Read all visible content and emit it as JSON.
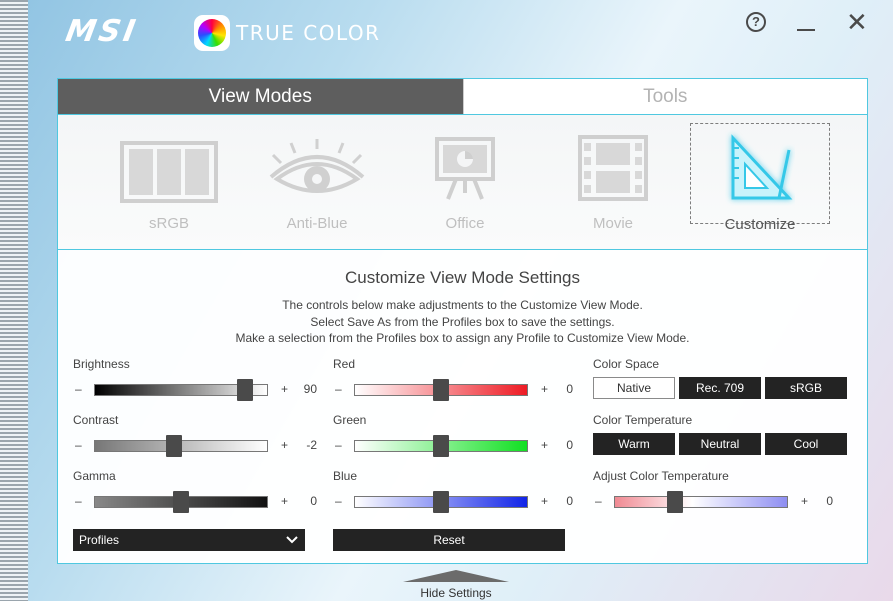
{
  "app": {
    "brand": "MSI",
    "title": "TRUE COLOR"
  },
  "tabs": [
    {
      "label": "View Modes",
      "active": true
    },
    {
      "label": "Tools",
      "active": false
    }
  ],
  "modes": [
    {
      "label": "sRGB",
      "icon": "srgb-grid-icon",
      "selected": false
    },
    {
      "label": "Anti-Blue",
      "icon": "eye-icon",
      "selected": false
    },
    {
      "label": "Office",
      "icon": "presentation-board-icon",
      "selected": false
    },
    {
      "label": "Movie",
      "icon": "film-strip-icon",
      "selected": false
    },
    {
      "label": "Customize",
      "icon": "set-square-icon",
      "selected": true
    }
  ],
  "settings": {
    "title": "Customize View Mode Settings",
    "desc_lines": [
      "The controls below make adjustments to the Customize View Mode.",
      "Select Save As from the Profiles box to save the settings.",
      "Make a selection from the Profiles box to assign any Profile to Customize View Mode."
    ],
    "sliders": {
      "brightness": {
        "label": "Brightness",
        "value": "90",
        "position": 0.87
      },
      "contrast": {
        "label": "Contrast",
        "value": "-2",
        "position": 0.46
      },
      "gamma": {
        "label": "Gamma",
        "value": "0",
        "position": 0.5
      },
      "red": {
        "label": "Red",
        "value": "0",
        "position": 0.5
      },
      "green": {
        "label": "Green",
        "value": "0",
        "position": 0.5
      },
      "blue": {
        "label": "Blue",
        "value": "0",
        "position": 0.5
      },
      "adjust_temp": {
        "label": "Adjust Color Temperature",
        "value": "0",
        "position": 0.35
      }
    },
    "minus": "–",
    "plus": "+",
    "color_space": {
      "label": "Color Space",
      "options": [
        "Native",
        "Rec. 709",
        "sRGB"
      ],
      "selected": "Native"
    },
    "color_temperature": {
      "label": "Color Temperature",
      "options": [
        "Warm",
        "Neutral",
        "Cool"
      ]
    },
    "profiles_label": "Profiles",
    "reset_label": "Reset"
  },
  "hide_settings": "Hide Settings",
  "colors": {
    "accent": "#4fc8e0",
    "tab_active": "#5e5e5e",
    "button_dark": "#232323"
  }
}
